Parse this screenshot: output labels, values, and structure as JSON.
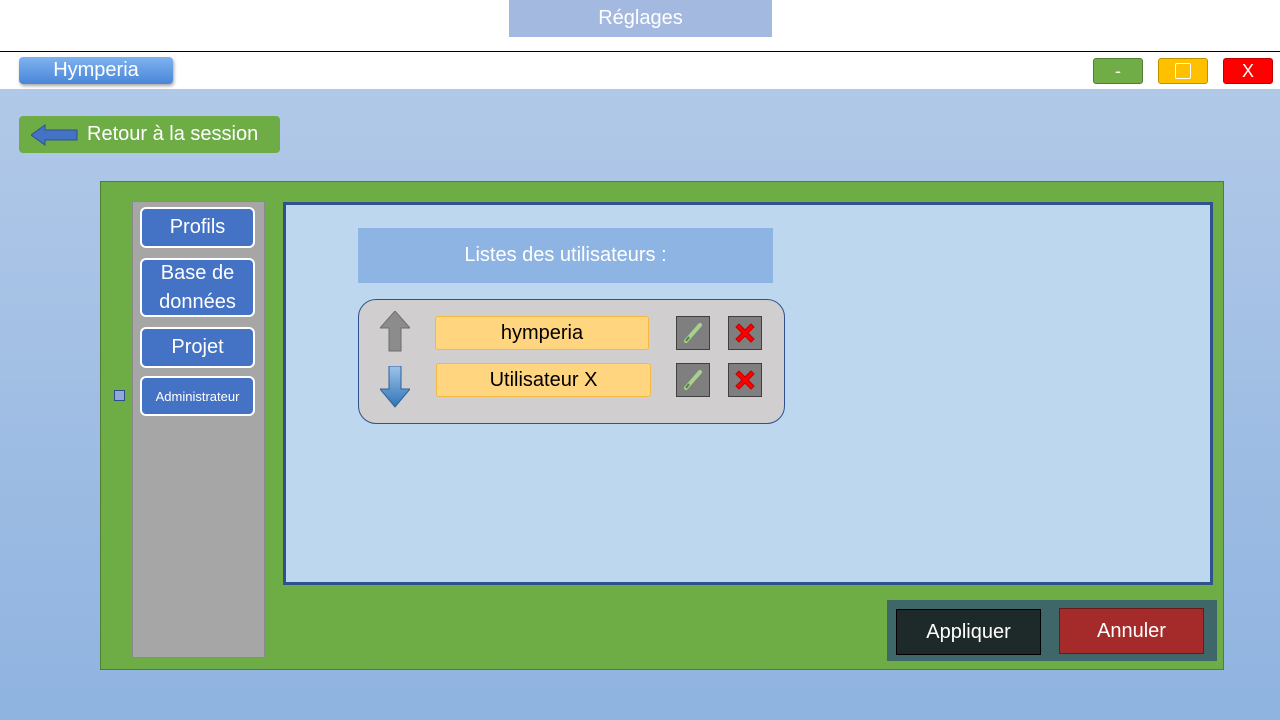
{
  "window_title": "Réglages",
  "titlebar": {
    "app_name": "Hymperia",
    "minimize_label": "-",
    "close_label": "X",
    "colors": {
      "minimize": "#70ad47",
      "maximize": "#ffc000",
      "close": "#ff0000"
    }
  },
  "back_button": {
    "label": "Retour à la session",
    "icon": "arrow-left-icon"
  },
  "sidebar": {
    "items": [
      {
        "label": "Profils"
      },
      {
        "label": "Base de données"
      },
      {
        "label": "Projet"
      },
      {
        "label": "Administrateur"
      }
    ]
  },
  "user_list": {
    "header": "Listes des utilisateurs :",
    "users": [
      {
        "name": "hymperia"
      },
      {
        "name": "Utilisateur X"
      }
    ],
    "icons": {
      "move_up": "arrow-up-icon",
      "move_down": "arrow-down-icon",
      "edit": "pencil-icon",
      "delete": "red-x-icon"
    }
  },
  "actions": {
    "apply_label": "Appliquer",
    "cancel_label": "Annuler"
  }
}
